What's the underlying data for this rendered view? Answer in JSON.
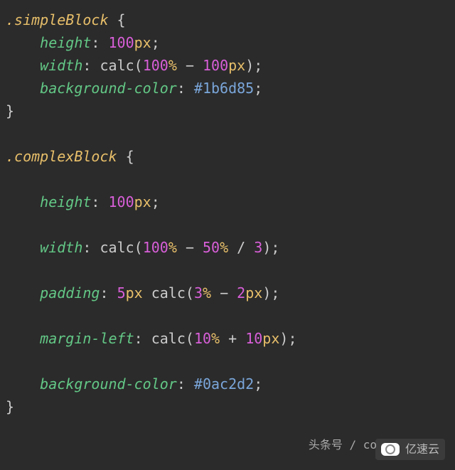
{
  "code": {
    "block1": {
      "selector": ".simpleBlock",
      "rules": [
        {
          "prop": "height",
          "tokens": [
            {
              "t": "num",
              "v": "100"
            },
            {
              "t": "unit",
              "v": "px"
            }
          ]
        },
        {
          "prop": "width",
          "tokens": [
            {
              "t": "func",
              "v": "calc("
            },
            {
              "t": "num",
              "v": "100"
            },
            {
              "t": "unit",
              "v": "%"
            },
            {
              "t": "func",
              "v": " − "
            },
            {
              "t": "num",
              "v": "100"
            },
            {
              "t": "unit",
              "v": "px"
            },
            {
              "t": "func",
              "v": ")"
            }
          ]
        },
        {
          "prop": "background-color",
          "tokens": [
            {
              "t": "hex",
              "v": "#1b6d85"
            }
          ]
        }
      ]
    },
    "block2": {
      "selector": ".complexBlock",
      "rules": [
        {
          "prop": "height",
          "tokens": [
            {
              "t": "num",
              "v": "100"
            },
            {
              "t": "unit",
              "v": "px"
            }
          ]
        },
        {
          "prop": "width",
          "tokens": [
            {
              "t": "func",
              "v": "calc("
            },
            {
              "t": "num",
              "v": "100"
            },
            {
              "t": "unit",
              "v": "%"
            },
            {
              "t": "func",
              "v": " − "
            },
            {
              "t": "num",
              "v": "50"
            },
            {
              "t": "unit",
              "v": "%"
            },
            {
              "t": "func",
              "v": " / "
            },
            {
              "t": "num",
              "v": "3"
            },
            {
              "t": "func",
              "v": ")"
            }
          ]
        },
        {
          "prop": "padding",
          "tokens": [
            {
              "t": "num",
              "v": "5"
            },
            {
              "t": "unit",
              "v": "px"
            },
            {
              "t": "func",
              "v": " calc("
            },
            {
              "t": "num",
              "v": "3"
            },
            {
              "t": "unit",
              "v": "%"
            },
            {
              "t": "func",
              "v": " − "
            },
            {
              "t": "num",
              "v": "2"
            },
            {
              "t": "unit",
              "v": "px"
            },
            {
              "t": "func",
              "v": ")"
            }
          ]
        },
        {
          "prop": "margin-left",
          "tokens": [
            {
              "t": "func",
              "v": "calc("
            },
            {
              "t": "num",
              "v": "10"
            },
            {
              "t": "unit",
              "v": "%"
            },
            {
              "t": "func",
              "v": " + "
            },
            {
              "t": "num",
              "v": "10"
            },
            {
              "t": "unit",
              "v": "px"
            },
            {
              "t": "func",
              "v": ")"
            }
          ]
        },
        {
          "prop": "background-color",
          "tokens": [
            {
              "t": "hex",
              "v": "#0ac2d2"
            }
          ]
        }
      ]
    }
  },
  "watermark": {
    "source": "头条号 / co",
    "brand": "亿速云"
  }
}
